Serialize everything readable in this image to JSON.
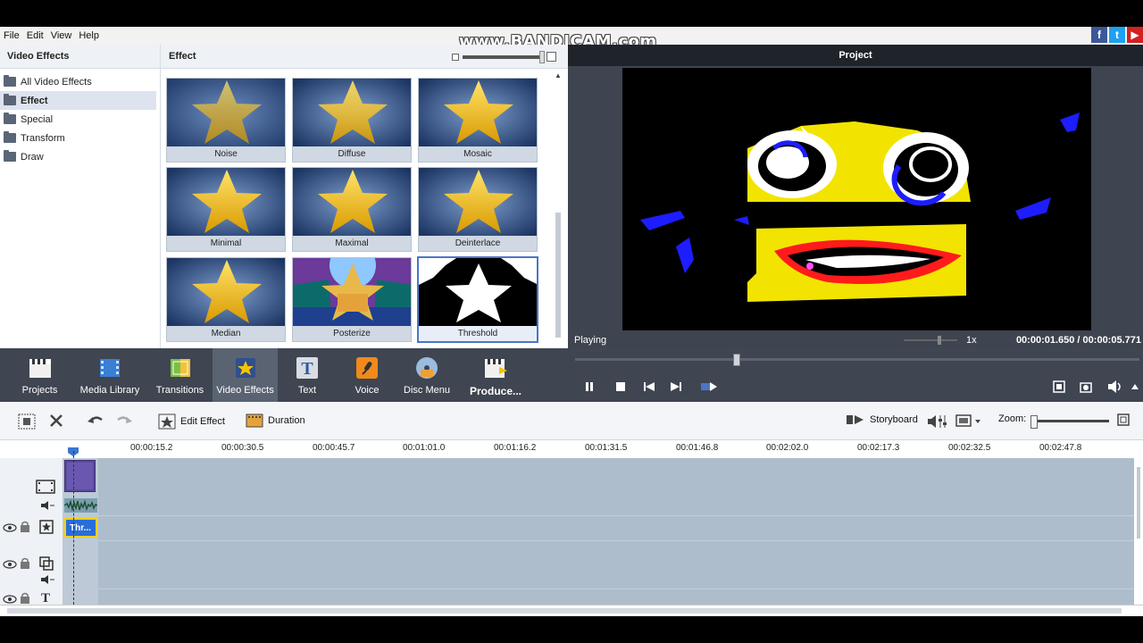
{
  "watermark": "www.BANDICAM.com",
  "menu": [
    "File",
    "Edit",
    "View",
    "Help"
  ],
  "social_icons": [
    "facebook-icon",
    "twitter-icon",
    "youtube-icon"
  ],
  "left_panel": {
    "title": "Video Effects",
    "categories": [
      "All Video Effects",
      "Effect",
      "Special",
      "Transform",
      "Draw"
    ],
    "selected": "Effect"
  },
  "effects_panel": {
    "title": "Effect",
    "tiles": [
      "Noise",
      "Diffuse",
      "Mosaic",
      "Minimal",
      "Maximal",
      "Deinterlace",
      "Median",
      "Posterize",
      "Threshold"
    ],
    "selected": "Threshold"
  },
  "preview": {
    "title": "Project",
    "status": "Playing",
    "speed": "1x",
    "time": "00:00:01.650 / 00:00:05.771"
  },
  "toolbar": {
    "items": [
      "Projects",
      "Media Library",
      "Transitions",
      "Video Effects",
      "Text",
      "Voice",
      "Disc Menu",
      "Produce..."
    ],
    "active": "Video Effects"
  },
  "timeline_toolbar": {
    "edit_effect": "Edit Effect",
    "duration": "Duration",
    "storyboard": "Storyboard",
    "zoom_label": "Zoom:"
  },
  "ruler": [
    "00:00:15.2",
    "00:00:30.5",
    "00:00:45.7",
    "00:01:01.0",
    "00:01:16.2",
    "00:01:31.5",
    "00:01:46.8",
    "00:02:02.0",
    "00:02:17.3",
    "00:02:32.5",
    "00:02:47.8"
  ],
  "effect_clip_label": "Thr..."
}
